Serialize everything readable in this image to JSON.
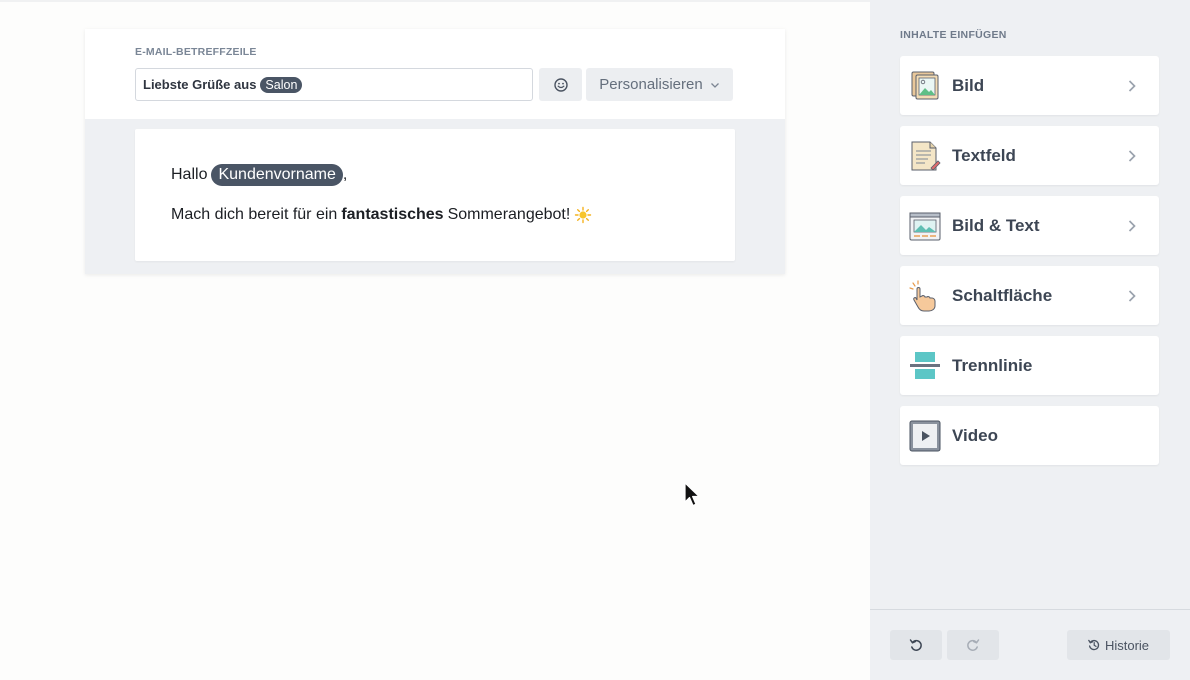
{
  "editor": {
    "subject_label": "E-MAIL-BETREFFZEILE",
    "subject_text": "Liebste Grüße aus",
    "subject_chip": "Salon",
    "emoji_icon": "smiley-icon",
    "personalize_label": "Personalisieren",
    "body": {
      "greeting_prefix": "Hallo",
      "greeting_chip": "Kundenvorname",
      "greeting_suffix": ",",
      "line_start": "Mach dich bereit für ein",
      "line_bold": "fantastisches",
      "line_end": "Sommerangebot!",
      "line_emoji": "☀️"
    }
  },
  "sidebar": {
    "heading": "INHALTE EINFÜGEN",
    "items": [
      {
        "label": "Bild",
        "icon": "image-icon",
        "has_chevron": true
      },
      {
        "label": "Textfeld",
        "icon": "textfield-icon",
        "has_chevron": true
      },
      {
        "label": "Bild & Text",
        "icon": "image-text-icon",
        "has_chevron": true
      },
      {
        "label": "Schaltfläche",
        "icon": "hand-pointer-icon",
        "has_chevron": true
      },
      {
        "label": "Trennlinie",
        "icon": "divider-icon",
        "has_chevron": false
      },
      {
        "label": "Video",
        "icon": "video-icon",
        "has_chevron": false
      }
    ],
    "footer": {
      "undo_icon": "undo-icon",
      "redo_icon": "redo-icon",
      "history_label": "Historie"
    }
  },
  "colors": {
    "chip": "#4a5565",
    "sidebar_bg": "#eef0f3",
    "canvas_bg": "#eef0f3",
    "accent_teal": "#5cc6c6"
  }
}
